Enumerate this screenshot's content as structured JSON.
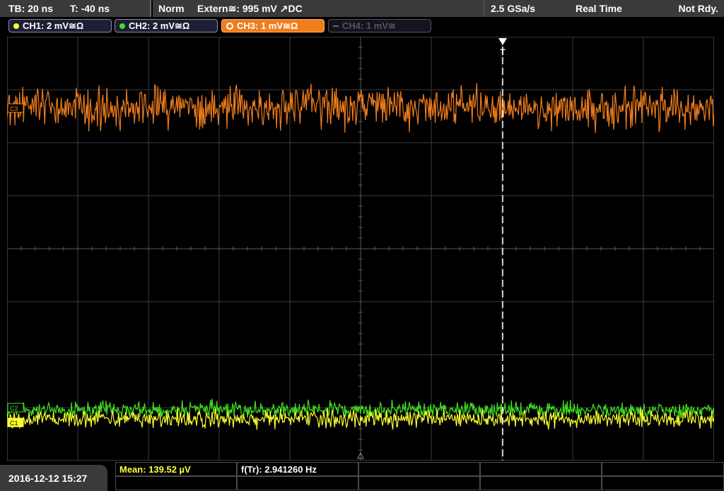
{
  "header": {
    "timebase": "TB: 20 ns",
    "trigger_offset": "T: -40 ns",
    "trigger_mode": "Norm",
    "trigger_source": "Extern≅: 995 mV ↗DC",
    "sample_rate": "2.5 GSa/s",
    "acquisition": "Real Time",
    "state": "Not Rdy."
  },
  "channels": [
    {
      "label": "CH1: 2 mV≅Ω",
      "color": "#ffff30"
    },
    {
      "label": "CH2: 2 mV≅Ω",
      "color": "#40e020"
    },
    {
      "label": "CH3: 1 mV≅Ω",
      "color": "#f07d1c"
    },
    {
      "label": "CH4: 1 mV≅",
      "color": "#666666"
    }
  ],
  "markers": {
    "trigger_label": "T",
    "ch3_marker": "C3",
    "ch2_marker": "C2",
    "ch1_marker": "C1"
  },
  "measurements": {
    "date": "2016-12-12 15:27",
    "mean": "Mean: 139.52 µV",
    "frequency": "f(Tr): 2.941260 Hz"
  },
  "colors": {
    "grid": "#3c3c3c",
    "axis": "#5a5a5a",
    "trigger_line": "#ffffff"
  }
}
